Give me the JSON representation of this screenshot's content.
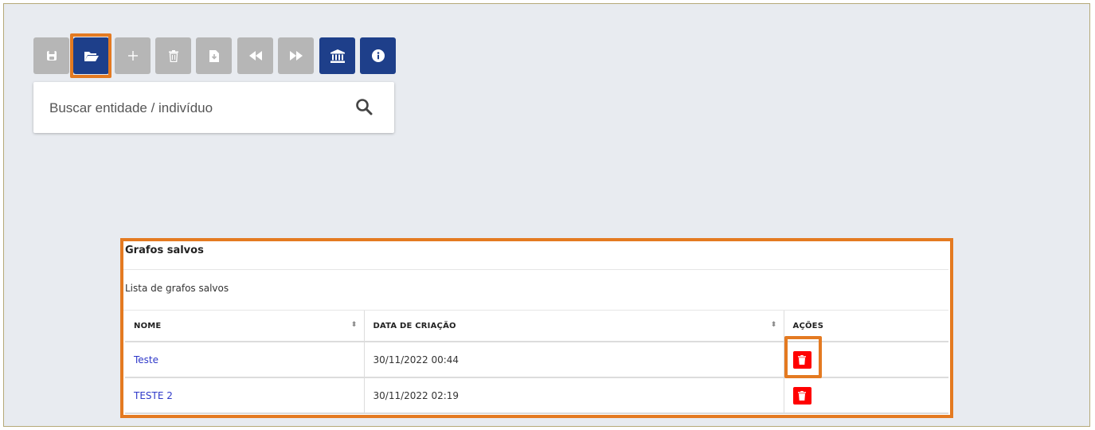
{
  "toolbar": {
    "buttons": [
      {
        "name": "save-button",
        "icon": "floppy-icon",
        "active": false
      },
      {
        "name": "open-button",
        "icon": "folder-open-icon",
        "active": true
      },
      {
        "name": "add-button",
        "icon": "plus-icon",
        "active": false
      },
      {
        "name": "delete-button",
        "icon": "trash-icon",
        "active": false
      },
      {
        "name": "export-button",
        "icon": "file-download-icon",
        "active": false
      },
      {
        "name": "back-button",
        "icon": "backward-icon",
        "active": false
      },
      {
        "name": "forward-button",
        "icon": "forward-icon",
        "active": false
      },
      {
        "name": "institution-button",
        "icon": "bank-icon",
        "active": true
      },
      {
        "name": "info-button",
        "icon": "info-icon",
        "active": true
      }
    ]
  },
  "search": {
    "placeholder": "Buscar entidade / indivíduo"
  },
  "saved_graphs": {
    "title": "Grafos salvos",
    "description": "Lista de grafos salvos",
    "columns": [
      "NOME",
      "DATA DE CRIAÇÃO",
      "AÇÕES"
    ],
    "rows": [
      {
        "name": "Teste",
        "created": "30/11/2022 00:44"
      },
      {
        "name": "TESTE 2",
        "created": "30/11/2022 02:19"
      }
    ]
  },
  "colors": {
    "accent_blue": "#1e3f8a",
    "disabled_gray": "#b6b6b6",
    "highlight_orange": "#e47a21",
    "danger_red": "#ff0000",
    "link_blue": "#2f39c9"
  }
}
